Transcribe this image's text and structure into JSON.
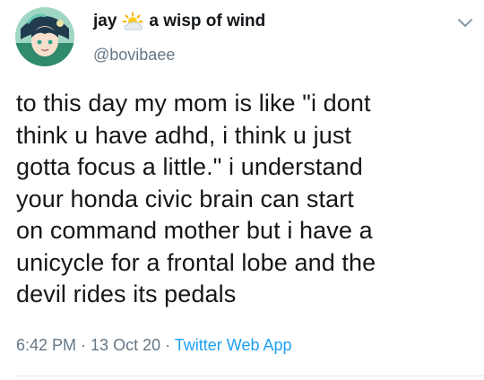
{
  "tweet": {
    "display_name": "jay",
    "name_emoji": "sun-behind-cloud-icon",
    "name_suffix": "a wisp of wind",
    "handle": "@bovibaee",
    "text_lines": [
      "to this day my mom is like \"i dont",
      "think u have adhd, i think u just",
      "gotta focus a little.\" i understand",
      "your honda civic brain can start",
      "on command mother but i have a",
      "unicycle for a frontal lobe and the",
      "devil rides its pedals"
    ],
    "time": "6:42 PM",
    "separator": " · ",
    "date": "13 Oct 20",
    "source": "Twitter Web App"
  },
  "colors": {
    "text": "#14171a",
    "secondary": "#657786",
    "link": "#1da1f2",
    "divider": "#e1e8ed"
  }
}
